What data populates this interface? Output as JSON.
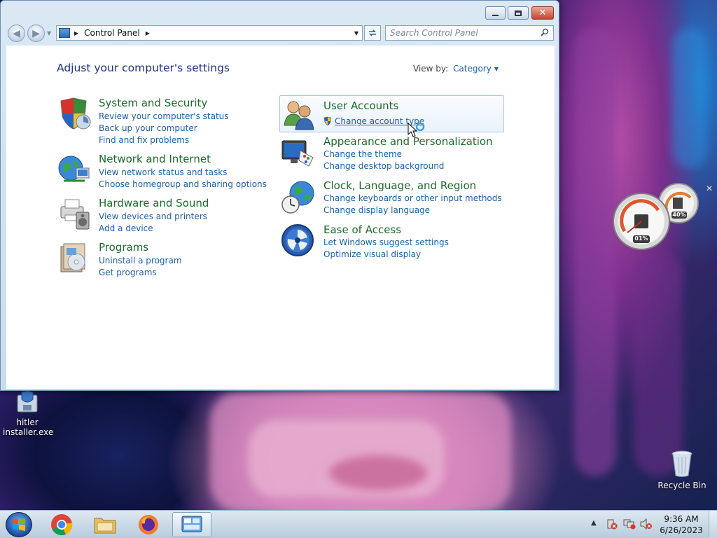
{
  "window": {
    "address_root_label": "Control Panel",
    "search_placeholder": "Search Control Panel",
    "heading": "Adjust your computer's settings",
    "view_by_label": "View by:",
    "view_by_value": "Category"
  },
  "categories": [
    {
      "title": "System and Security",
      "links": [
        "Review your computer's status",
        "Back up your computer",
        "Find and fix problems"
      ],
      "icon": "shield-icon"
    },
    {
      "title": "Network and Internet",
      "links": [
        "View network status and tasks",
        "Choose homegroup and sharing options"
      ],
      "icon": "globe-network-icon"
    },
    {
      "title": "Hardware and Sound",
      "links": [
        "View devices and printers",
        "Add a device"
      ],
      "icon": "printer-speaker-icon"
    },
    {
      "title": "Programs",
      "links": [
        "Uninstall a program",
        "Get programs"
      ],
      "icon": "programs-box-icon"
    },
    {
      "title": "User Accounts",
      "links": [
        "Change account type"
      ],
      "icon": "users-icon"
    },
    {
      "title": "Appearance and Personalization",
      "links": [
        "Change the theme",
        "Change desktop background"
      ],
      "icon": "monitor-palette-icon"
    },
    {
      "title": "Clock, Language, and Region",
      "links": [
        "Change keyboards or other input methods",
        "Change display language"
      ],
      "icon": "globe-clock-icon"
    },
    {
      "title": "Ease of Access",
      "links": [
        "Let Windows suggest settings",
        "Optimize visual display"
      ],
      "icon": "ease-of-access-icon"
    }
  ],
  "desktop": {
    "installer_label": "hitler installer.exe",
    "recycle_bin_label": "Recycle Bin"
  },
  "gadget": {
    "cpu_label": "01%",
    "memory_label": "40%"
  },
  "taskbar": {
    "time": "9:36 AM",
    "date": "6/26/2023"
  },
  "colors": {
    "category_title": "#1c6a2b",
    "link": "#1e5fa9",
    "heading": "#1e3287"
  }
}
